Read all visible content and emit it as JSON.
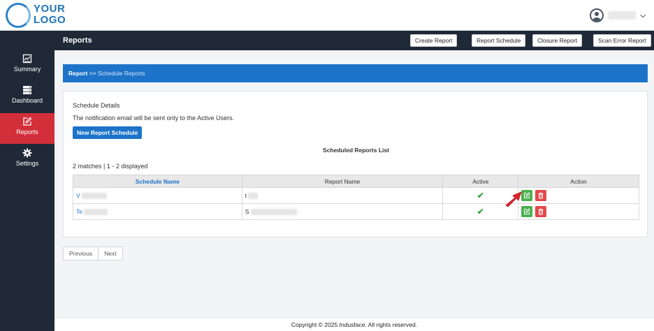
{
  "logo": {
    "line1": "YOUR",
    "line2": "LOGO"
  },
  "user": {
    "icon": "user-circle-icon",
    "dropdown_icon": "chevron-down-icon"
  },
  "sidebar": {
    "items": [
      {
        "label": "Summary",
        "icon": "summary-icon"
      },
      {
        "label": "Dashboard",
        "icon": "server-icon"
      },
      {
        "label": "Reports",
        "icon": "edit-icon",
        "active": true
      },
      {
        "label": "Settings",
        "icon": "gear-icon"
      }
    ]
  },
  "page": {
    "title": "Reports"
  },
  "toolbar": {
    "create_report": "Create Report",
    "report_schedule": "Report Schedule",
    "closure_report": "Closure Report",
    "scan_error_report": "Scan Error Report"
  },
  "breadcrumb": {
    "root": "Report",
    "separator": ">>",
    "current": "Schedule Reports"
  },
  "panel": {
    "title": "Schedule Details",
    "note": "The notification email will be sent only to the Active Users.",
    "new_schedule_button": "New Report Schedule",
    "list_title": "Scheduled Reports List",
    "match_info": "2 matches | 1 - 2 displayed"
  },
  "table": {
    "headers": [
      "Schedule Name",
      "Report Name",
      "Active",
      "Action"
    ],
    "rows": [
      {
        "schedule_name": "V",
        "report_name": "t",
        "active": "✔"
      },
      {
        "schedule_name": "Te",
        "report_name": "S",
        "active": "✔"
      }
    ]
  },
  "pagination": {
    "previous": "Previous",
    "next": "Next"
  },
  "footer": {
    "text": "Copyright © 2025 Indusface. All rights reserved."
  },
  "colors": {
    "sidebar_bg": "#1f2937",
    "active_item": "#d32f3a",
    "primary": "#1d73c9",
    "edit_button": "#4cb050",
    "delete_button": "#e2484a",
    "check": "#3aa64a"
  }
}
